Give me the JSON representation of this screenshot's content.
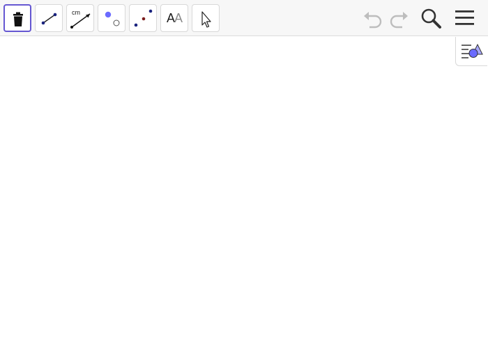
{
  "toolbar": {
    "tools": [
      {
        "icon": "trash-icon",
        "selected": true
      },
      {
        "icon": "segment-icon"
      },
      {
        "icon": "segment-with-length-icon",
        "label": "cm"
      },
      {
        "icon": "point-icon"
      },
      {
        "icon": "point-on-object-icon"
      },
      {
        "icon": "text-tool-icon",
        "label_primary": "A",
        "label_secondary": "A"
      },
      {
        "icon": "move-pointer-icon"
      }
    ],
    "right_buttons": [
      "undo-icon",
      "redo-icon",
      "search-icon",
      "menu-icon"
    ]
  },
  "algebra_toggle": {
    "icon": "algebra-view-icon"
  },
  "colors": {
    "accent": "#6557d2",
    "point_blue": "#6b6bff",
    "dark_blue": "#1a237e",
    "dark_red": "#7b1d1d",
    "icon_dark": "#333333",
    "icon_disabled": "#bdbdbd"
  }
}
